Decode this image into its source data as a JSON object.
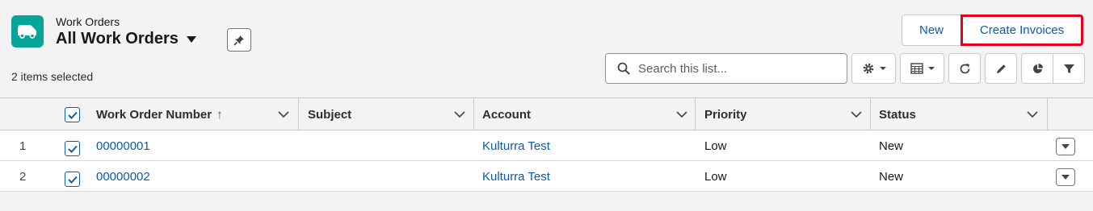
{
  "header": {
    "object_type": "Work Orders",
    "list_title": "All Work Orders",
    "selected_count": "2 items selected"
  },
  "actions": {
    "new_label": "New",
    "create_invoices_label": "Create Invoices"
  },
  "search": {
    "placeholder": "Search this list..."
  },
  "colors": {
    "brand_icon": "#06a59a",
    "link": "#0b5cab",
    "highlight_border": "#e3001b"
  },
  "table": {
    "columns": [
      {
        "label": "Work Order Number",
        "sorted": "ascending"
      },
      {
        "label": "Subject"
      },
      {
        "label": "Account"
      },
      {
        "label": "Priority"
      },
      {
        "label": "Status"
      }
    ],
    "rows": [
      {
        "num": "1",
        "work_order_number": "00000001",
        "subject": "",
        "account": "Kulturra Test",
        "priority": "Low",
        "status": "New",
        "selected": true
      },
      {
        "num": "2",
        "work_order_number": "00000002",
        "subject": "",
        "account": "Kulturra Test",
        "priority": "Low",
        "status": "New",
        "selected": true
      }
    ]
  },
  "icons": [
    "van-icon",
    "pin-icon",
    "search-icon",
    "gear-icon",
    "table-icon",
    "refresh-icon",
    "pencil-icon",
    "pie-chart-icon",
    "filter-icon",
    "sort-arrow-up-icon",
    "chevron-down-icon",
    "checkbox-icon"
  ]
}
